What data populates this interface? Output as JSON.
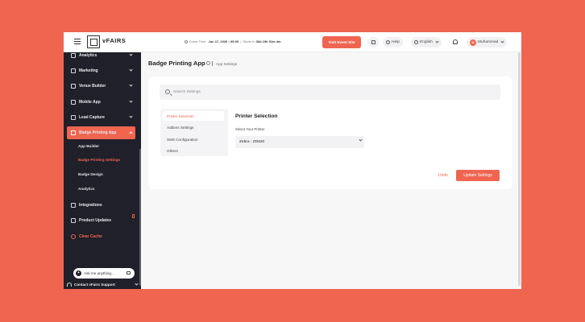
{
  "app": {
    "logo_text": "vFAIRS"
  },
  "topbar": {
    "event_time_label": "Event Time :",
    "event_time_value": "Jun 17, 2026 • 09:00",
    "starts_in_label": "Starts In",
    "starts_in_value": "36d 19h 51m 4m",
    "visit_button": "Visit Event Site",
    "help": "Help",
    "language": "English",
    "user_name": "Muhammad",
    "user_initials": "M"
  },
  "sidebar": {
    "items": [
      {
        "label": "Analytics"
      },
      {
        "label": "Marketing"
      },
      {
        "label": "Venue Builder"
      },
      {
        "label": "Mobile App"
      },
      {
        "label": "Lead Capture"
      },
      {
        "label": "Badge Printing App"
      }
    ],
    "sub_items": [
      {
        "label": "App Builder"
      },
      {
        "label": "Badge Printing Settings"
      },
      {
        "label": "Badge Design"
      },
      {
        "label": "Analytics"
      }
    ],
    "lower_items": [
      {
        "label": "Integrations"
      },
      {
        "label": "Product Updates"
      },
      {
        "label": "Clear Cache"
      }
    ],
    "ask_placeholder": "Ask me anything...",
    "support": "Contact vFairs Support"
  },
  "page": {
    "title": "Badge Printing App",
    "breadcrumb": "App Settings"
  },
  "settings": {
    "search_placeholder": "Search Settings",
    "tabs": [
      {
        "label": "Printer Selection"
      },
      {
        "label": "Addons Settings"
      },
      {
        "label": "SMS Configuration"
      },
      {
        "label": "Others"
      }
    ],
    "panel_title": "Printer Selection",
    "field_label": "Select Your Printer",
    "printer_value": "Zebra - ZD620",
    "undo": "Undo",
    "update": "Update Settings"
  },
  "colors": {
    "accent": "#ef6550",
    "sidebar_bg": "#1f2029",
    "page_bg": "#f7f7f8"
  }
}
